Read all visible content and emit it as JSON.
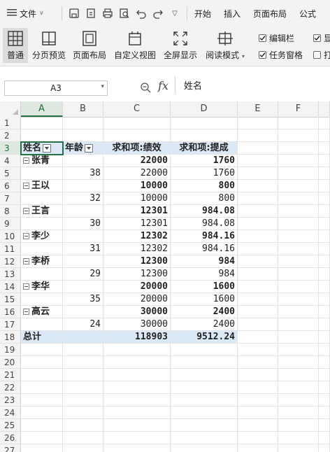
{
  "menubar": {
    "file_label": "文件",
    "tabs": [
      "开始",
      "插入",
      "页面布局",
      "公式"
    ]
  },
  "toolbar": {
    "tools": [
      {
        "label": "普通",
        "icon": "normal-view-icon",
        "active": true
      },
      {
        "label": "分页预览",
        "icon": "page-break-preview-icon"
      },
      {
        "label": "页面布局",
        "icon": "page-layout-icon"
      },
      {
        "label": "自定义视图",
        "icon": "custom-view-icon"
      },
      {
        "label": "全屏显示",
        "icon": "fullscreen-icon"
      },
      {
        "label": "阅读模式",
        "icon": "reading-mode-icon"
      }
    ],
    "checkboxes": [
      {
        "label": "编辑栏",
        "checked": true
      },
      {
        "label": "任务窗格",
        "checked": true
      },
      {
        "label": "显",
        "checked": true
      },
      {
        "label": "打",
        "checked": false
      }
    ]
  },
  "formula_bar": {
    "name_box": "A3",
    "fx": "fx",
    "content": "姓名"
  },
  "grid": {
    "columns": [
      "A",
      "B",
      "C",
      "D",
      "E",
      "F"
    ],
    "selected_column": "A",
    "selected_row": "3",
    "row_numbers": [
      "1",
      "2",
      "3",
      "4",
      "5",
      "6",
      "7",
      "8",
      "9",
      "10",
      "11",
      "12",
      "13",
      "14",
      "15",
      "16",
      "17",
      "18",
      "19",
      "20",
      "21",
      "22",
      "23",
      "24",
      "25",
      "26",
      "27"
    ],
    "pivot": {
      "headers": [
        "姓名",
        "年龄",
        "求和项:绩效",
        "求和项:提成"
      ],
      "groups": [
        {
          "name": "张青",
          "perf": "22000",
          "comm": "1760",
          "age": "38",
          "perf_d": "22000",
          "comm_d": "1760"
        },
        {
          "name": "王以",
          "perf": "10000",
          "comm": "800",
          "age": "32",
          "perf_d": "10000",
          "comm_d": "800"
        },
        {
          "name": "王言",
          "perf": "12301",
          "comm": "984.08",
          "age": "30",
          "perf_d": "12301",
          "comm_d": "984.08"
        },
        {
          "name": "李少",
          "perf": "12302",
          "comm": "984.16",
          "age": "31",
          "perf_d": "12302",
          "comm_d": "984.16"
        },
        {
          "name": "李桥",
          "perf": "12300",
          "comm": "984",
          "age": "29",
          "perf_d": "12300",
          "comm_d": "984"
        },
        {
          "name": "李华",
          "perf": "20000",
          "comm": "1600",
          "age": "35",
          "perf_d": "20000",
          "comm_d": "1600"
        },
        {
          "name": "高云",
          "perf": "30000",
          "comm": "2400",
          "age": "24",
          "perf_d": "30000",
          "comm_d": "2400"
        }
      ],
      "total_label": "总计",
      "total_perf": "118903",
      "total_comm": "9512.24"
    }
  }
}
